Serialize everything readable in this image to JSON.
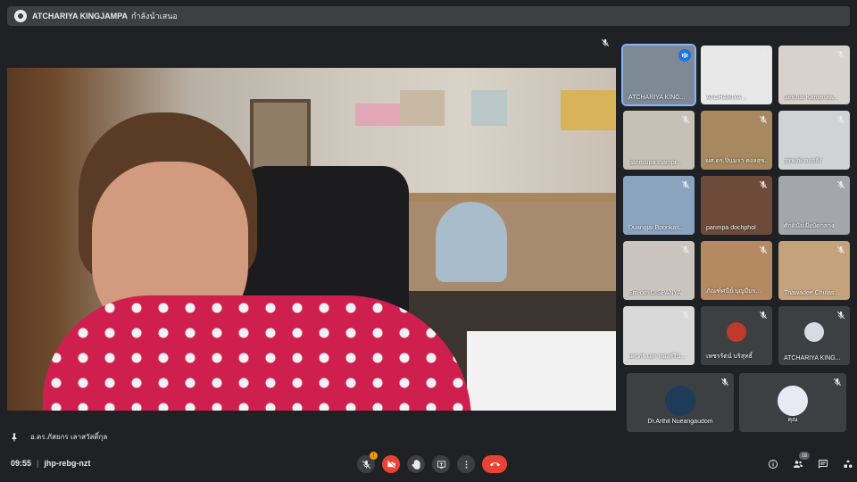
{
  "topbar": {
    "presenter": "ATCHARIYA KINGJAMPA",
    "status": "กำลังนำเสนอ"
  },
  "main": {
    "speaker": "อ.ดร.ภัสยกร เลาสวัสดิ์กุล"
  },
  "tiles": [
    {
      "name": "ATCHARIYA KING...",
      "thumb": "#7d8a96"
    },
    {
      "name": "ATCHARIYA ...",
      "thumb": "#e8e8e8"
    },
    {
      "name": "Sirichai Kanjanaw...",
      "thumb": "#d7d2cb"
    },
    {
      "name": "panitsupa thampr...",
      "thumb": "#c7c0b6"
    },
    {
      "name": "ผศ.ดร.ปิ่นมรา คงลสุข...",
      "thumb": "#a8895f"
    },
    {
      "name": "สุรพงษ์ คงลลัง",
      "thumb": "#cfd3d6"
    },
    {
      "name": "Duangjai Boonkas...",
      "thumb": "#8aa4c0"
    },
    {
      "name": "parimpa dochphol",
      "thumb": "#6d4a3a"
    },
    {
      "name": "ศักดินัย ฝังบัดกลาง",
      "thumb": "#a3a7ad"
    },
    {
      "name": "Em-orn DISPANYA",
      "thumb": "#c9c4be"
    },
    {
      "name": "ภัณฑ์ศนีย์ บุญมีบร...",
      "thumb": "#b58a62"
    },
    {
      "name": "Thawadee Chulas...",
      "thumb": "#c4a27b"
    },
    {
      "name": "ผศ.ดร.เอก ทองสรีน...",
      "thumb": "#d8d8d8"
    },
    {
      "name": "เพชรรัตน์ บริสุทธิ์",
      "thumb": "#3c4043"
    },
    {
      "name": "ATCHARIYA KING...",
      "thumb": "#3c4043"
    },
    {
      "name": "Dr.Arthit Nueangaudom",
      "thumb": "#3c4043"
    },
    {
      "name": "คุณ",
      "thumb": "#3c4043"
    }
  ],
  "bottombar": {
    "time": "09:55",
    "meeting_code": "jhp-rebg-nzt",
    "mic_badge": "!",
    "people_count": "18"
  },
  "icons": {
    "mic": "mic-off-icon",
    "camera": "camera-off-icon",
    "hand": "raise-hand-icon",
    "present": "present-screen-icon",
    "more": "more-options-icon",
    "hangup": "end-call-icon",
    "info": "info-icon",
    "people": "people-icon",
    "chat": "chat-icon",
    "activities": "activities-icon"
  },
  "colors": {
    "accent": "#8ab4f8",
    "danger": "#ea4335",
    "background": "#202124",
    "surface": "#3c4043"
  }
}
